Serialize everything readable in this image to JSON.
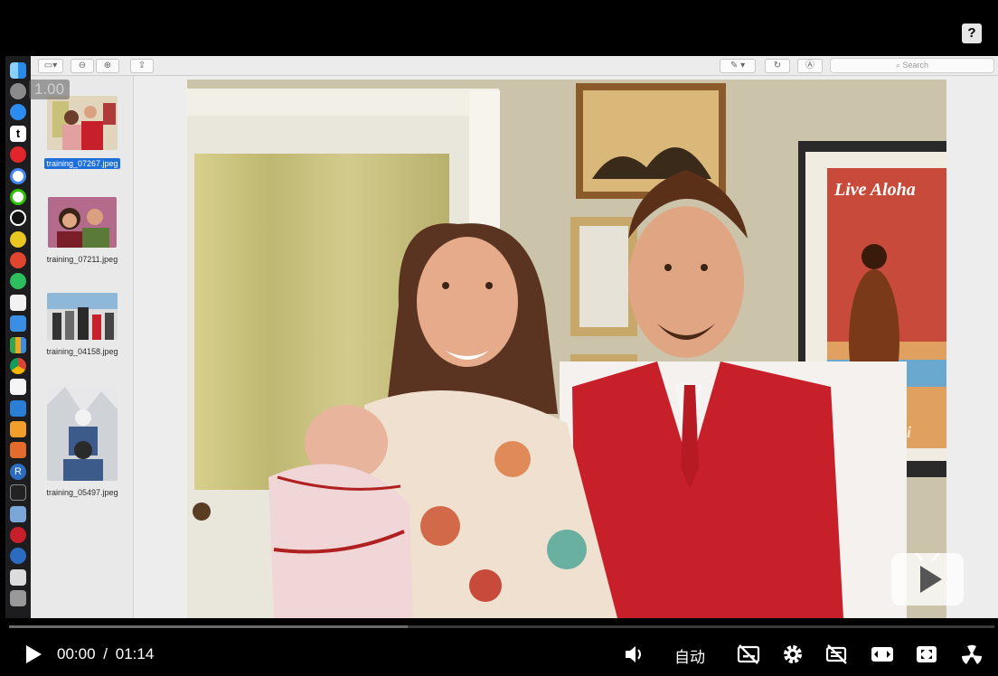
{
  "player": {
    "current_time": "00:00",
    "separator": "/",
    "duration": "01:14",
    "quality_label": "自动",
    "progress_fraction": 0.0,
    "buffered_fraction": 0.405,
    "help_label": "?"
  },
  "overlay": {
    "speed_label": "1.00"
  },
  "preview_app": {
    "search_placeholder": "Search",
    "thumbnails": [
      {
        "filename": "training_07267.jpeg",
        "selected": true
      },
      {
        "filename": "training_07211.jpeg",
        "selected": false
      },
      {
        "filename": "training_04158.jpeg",
        "selected": false
      },
      {
        "filename": "training_05497.jpeg",
        "selected": false
      }
    ],
    "photo_poster_text": "Live Aloha",
    "photo_poster_text2": "waii"
  },
  "dock": {
    "apps": [
      "finder-icon",
      "launchpad-icon",
      "safari-icon",
      "tumblr-icon",
      "weibo-icon",
      "google-icon",
      "wechat-icon",
      "qq-icon",
      "maps-icon",
      "app-icon",
      "evernote-icon",
      "textedit-icon",
      "keynote-icon",
      "numbers-icon",
      "chrome-icon",
      "paper-icon",
      "vscode-icon",
      "sublime-icon",
      "matlab-icon",
      "r-icon",
      "terminal-icon",
      "photos-icon",
      "spider-icon",
      "network-icon",
      "file-icon",
      "trash-icon"
    ]
  },
  "colors": {
    "accent_selected": "#1e6fd9",
    "vest_red": "#c8202a"
  }
}
